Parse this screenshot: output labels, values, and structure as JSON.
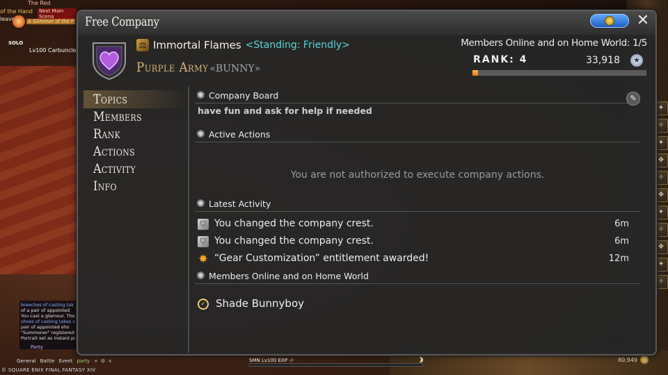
{
  "hud": {
    "top_red": "The Red",
    "quest_left": "of the Hand",
    "quest_title": "Next Main Scena",
    "quest_left2": "leave",
    "quest_sub": "A Glimmer of the P",
    "solo": "SOLO",
    "lv": "Lv100 Carbuncle"
  },
  "chat": {
    "lines": [
      {
        "text": "breeches of casting tak"
      },
      {
        "text": "of a  pair of appointed"
      },
      {
        "text": "You cast a glamour. The"
      },
      {
        "text": "shoes of casting takes c"
      },
      {
        "text": "pair of appointed sho"
      },
      {
        "text": "\"Summoner\" registered"
      },
      {
        "text": "Portrait set as instant po"
      }
    ],
    "party_label": "Party",
    "tabs": [
      "General",
      "Battle",
      "Event",
      "party"
    ],
    "copyright": "© SQUARE ENIX  FINAL FANTASY XIV"
  },
  "status_bar": {
    "job": "SMN",
    "level": "Lv100",
    "exp": "EXP -/-",
    "gil": "80,949"
  },
  "window": {
    "title": "Free Company",
    "close_symbol": "✕"
  },
  "header": {
    "fc_name": "Immortal Flames",
    "standing": "<Standing: Friendly>",
    "full_name": "Purple Army",
    "tag": "«BUNNY»",
    "members_online_text": "Members Online and on Home World: 1/5",
    "rank_label": "RANK: 4",
    "rank_points": "33,918",
    "rank_progress": 0.03
  },
  "nav": {
    "items": [
      {
        "label": "Topics"
      },
      {
        "label": "Members"
      },
      {
        "label": "Rank"
      },
      {
        "label": "Actions"
      },
      {
        "label": "Activity"
      },
      {
        "label": "Info"
      }
    ],
    "selected_index": 0
  },
  "content": {
    "board_title": "Company Board",
    "board_message": "have fun and ask for help if needed",
    "actions_title": "Active Actions",
    "actions_message": "You are not authorized to execute company actions.",
    "activity_title": "Latest Activity",
    "activity": [
      {
        "text": "You changed the company crest.",
        "time": "6m",
        "icon": "crest-change-icon"
      },
      {
        "text": "You changed the company crest.",
        "time": "6m",
        "icon": "crest-change-icon"
      },
      {
        "text": "“Gear Customization” entitlement awarded!",
        "time": "12m",
        "icon": "award-star-icon"
      }
    ],
    "members_title": "Members Online and on Home World",
    "members": [
      {
        "name": "Shade Bunnyboy",
        "icon": "online-status-icon"
      }
    ]
  },
  "colors": {
    "standing": "#59d6d6",
    "fc_full_name": "#d9b77a",
    "rank_bar_fill": "#e07a10"
  }
}
